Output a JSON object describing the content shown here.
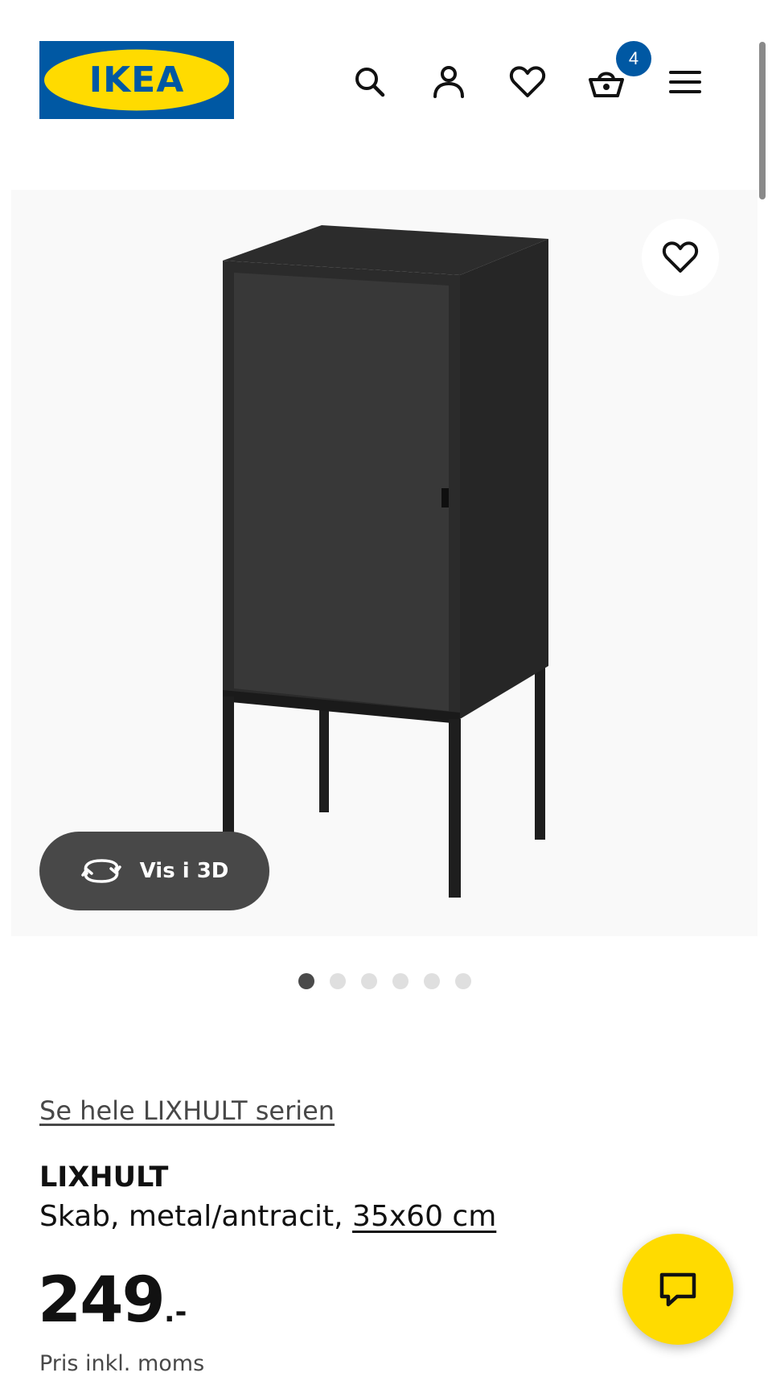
{
  "header": {
    "logo_text": "IKEA",
    "logo_colors": {
      "background": "#0058a3",
      "oval": "#ffdb00",
      "text": "#0058a3"
    },
    "icons": [
      "search-icon",
      "user-icon",
      "heart-icon",
      "basket-icon",
      "menu-icon"
    ],
    "cart_count": "4",
    "badge_color": "#0058a3"
  },
  "gallery": {
    "view_3d_label": "Vis i 3D",
    "view_3d_icon": "rotate-3d-icon",
    "favourite_icon": "heart-icon",
    "image_count": 6,
    "active_image": 1
  },
  "product": {
    "series_link": "Se hele LIXHULT serien",
    "name": "LIXHULT",
    "description": "Skab, metal/antracit, ",
    "size_link": "35x60 cm",
    "price_main": "249",
    "price_suffix": ".-",
    "vat_note": "Pris inkl. moms"
  },
  "chat": {
    "icon": "chat-bubble-icon",
    "color": "#ffdb00"
  }
}
